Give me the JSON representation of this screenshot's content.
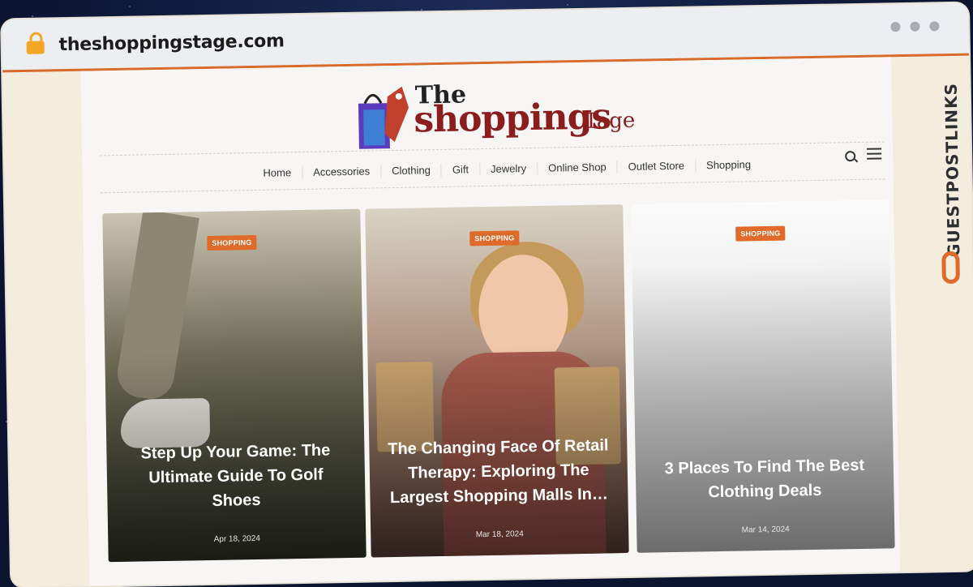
{
  "browser": {
    "url": "theshoppingstage.com"
  },
  "site": {
    "logo": {
      "the": "The",
      "main": "shoppings",
      "tage": "Tage"
    },
    "nav": [
      "Home",
      "Accessories",
      "Clothing",
      "Gift",
      "Jewelry",
      "Online Shop",
      "Outlet Store",
      "Shopping"
    ]
  },
  "cards": [
    {
      "badge": "SHOPPING",
      "title": "Step Up Your Game: The Ultimate Guide To Golf Shoes",
      "date": "Apr 18, 2024"
    },
    {
      "badge": "SHOPPING",
      "title": "The Changing Face Of Retail Therapy: Exploring The Largest Shopping Malls In…",
      "date": "Mar 18, 2024"
    },
    {
      "badge": "SHOPPING",
      "title": "3 Places To Find The Best Clothing Deals",
      "date": "Mar 14, 2024"
    }
  ],
  "watermark": "GUESTPOSTLINKS",
  "colors": {
    "accent": "#e06a2a",
    "brand": "#8b1d1d"
  }
}
